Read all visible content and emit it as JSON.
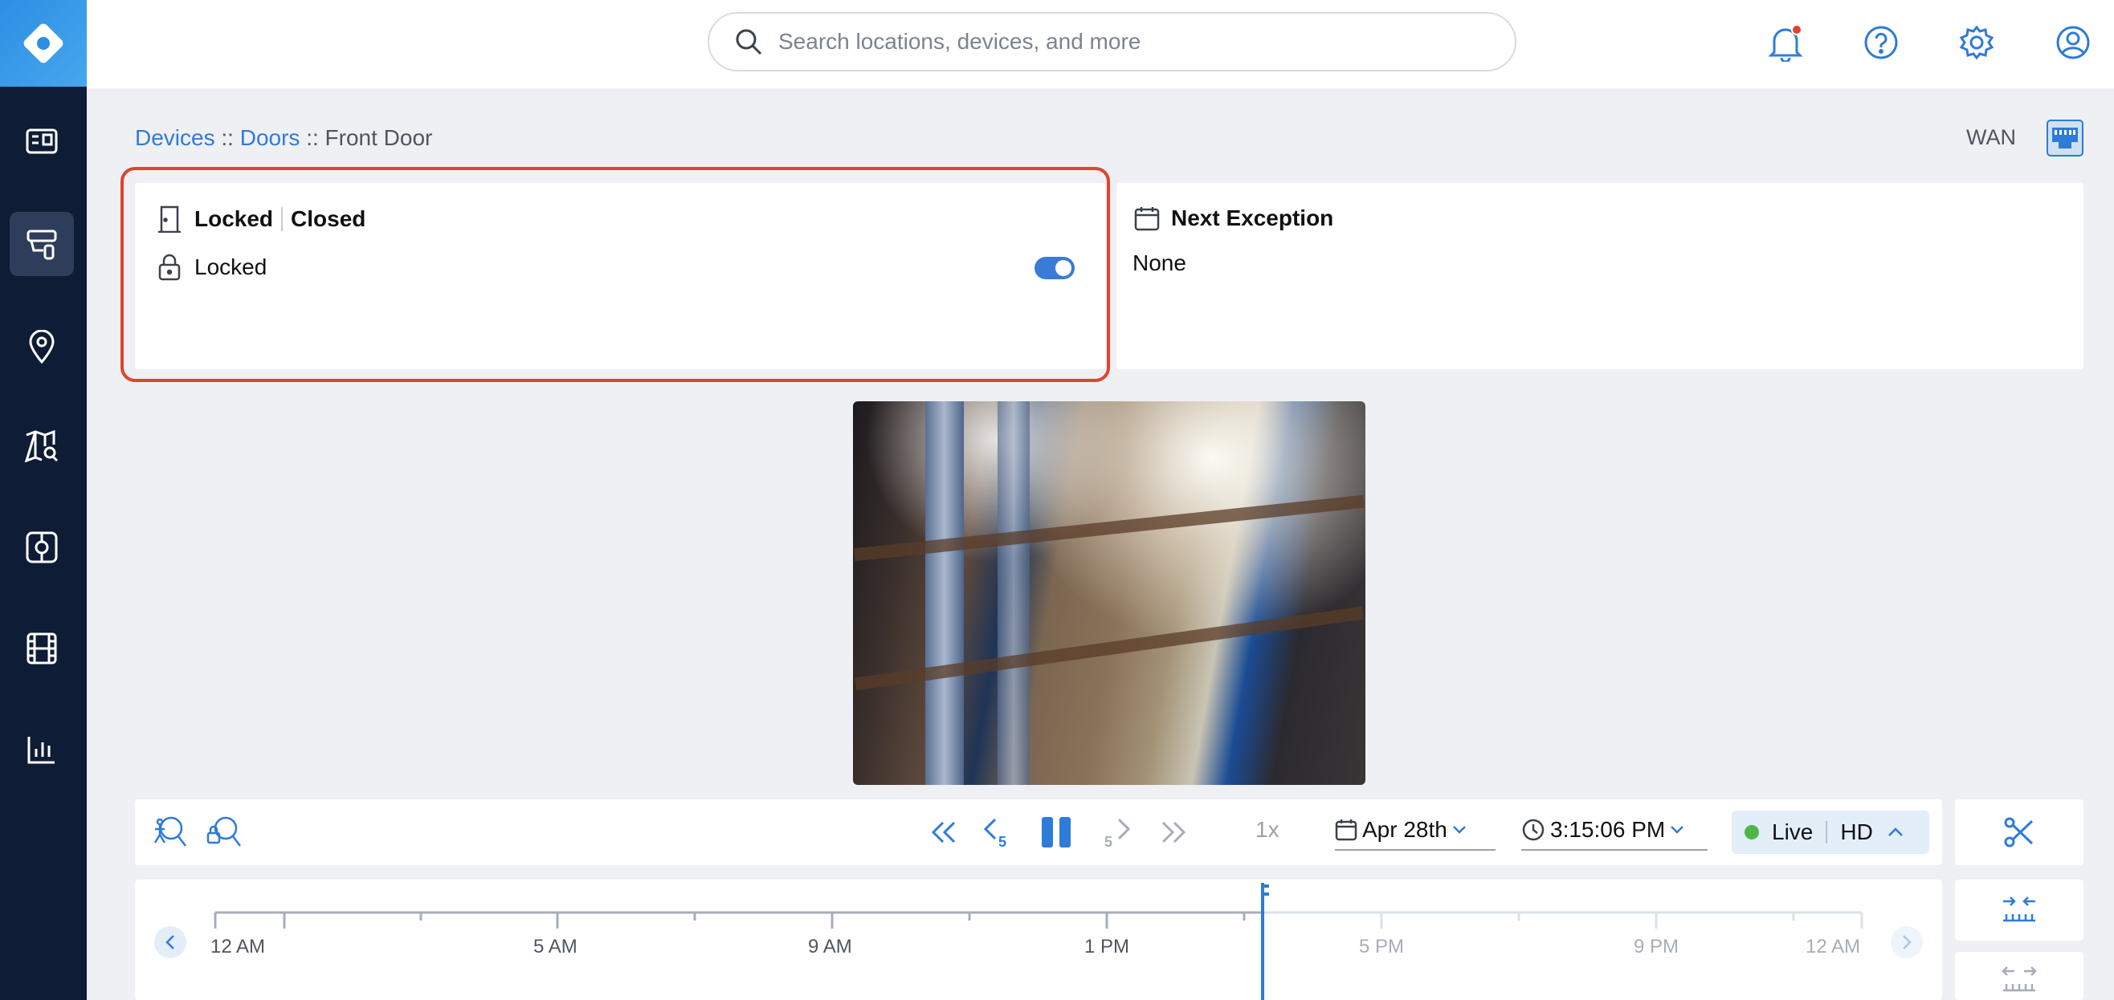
{
  "search": {
    "placeholder": "Search locations, devices, and more"
  },
  "topbar": {
    "icons": [
      "bell-icon",
      "help-icon",
      "gear-icon",
      "user-icon"
    ],
    "notification_dot_color": "#e0432f"
  },
  "sidebar": {
    "items": [
      {
        "name": "dashboard-icon"
      },
      {
        "name": "devices-icon",
        "active": true
      },
      {
        "name": "locations-icon"
      },
      {
        "name": "map-search-icon"
      },
      {
        "name": "access-icon"
      },
      {
        "name": "video-icon"
      },
      {
        "name": "reports-icon"
      }
    ]
  },
  "breadcrumb": {
    "devices": "Devices",
    "sep1": "::",
    "doors": "Doors",
    "sep2": "::",
    "current": "Front Door"
  },
  "network": {
    "label": "WAN"
  },
  "status_card": {
    "title_state": "Locked",
    "title_door": "Closed",
    "lock_label": "Locked",
    "lock_toggle_on": true
  },
  "exception_card": {
    "title": "Next Exception",
    "value": "None"
  },
  "playback": {
    "speed": "1x",
    "date": "Apr 28th",
    "time": "3:15:06 PM",
    "live_label": "Live",
    "quality_label": "HD"
  },
  "timeline": {
    "labels": [
      "12 AM",
      "5 AM",
      "9 AM",
      "1 PM",
      "5 PM",
      "9 PM",
      "12 AM"
    ]
  },
  "colors": {
    "accent": "#2f7bd8",
    "sidebar": "#0f1c36",
    "highlight": "#e0432f",
    "live": "#4fb648"
  }
}
